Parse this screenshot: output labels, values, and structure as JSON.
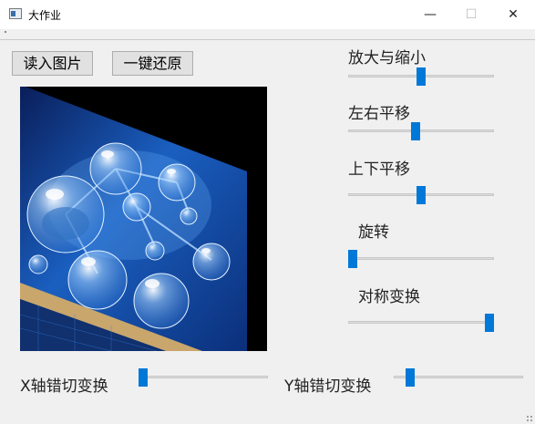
{
  "window": {
    "title": "大作业",
    "min": "—",
    "max": "☐",
    "close": "✕"
  },
  "buttons": {
    "load": "读入图片",
    "reset": "一键还原"
  },
  "sliders": [
    {
      "key": "zoom",
      "label": "放大与缩小",
      "value": 0.5
    },
    {
      "key": "hshift",
      "label": "左右平移",
      "value": 0.46
    },
    {
      "key": "vshift",
      "label": "上下平移",
      "value": 0.5
    },
    {
      "key": "rotate",
      "label": "旋转",
      "value": 0.0
    },
    {
      "key": "mirror",
      "label": "对称变换",
      "value": 1.0
    },
    {
      "key": "xshear",
      "label": "X轴错切变换",
      "value": 0.0
    },
    {
      "key": "yshear",
      "label": "Y轴错切变换",
      "value": 0.1
    }
  ],
  "icons": {
    "app": "window-app-icon",
    "image": "molecule-bubble-image"
  }
}
